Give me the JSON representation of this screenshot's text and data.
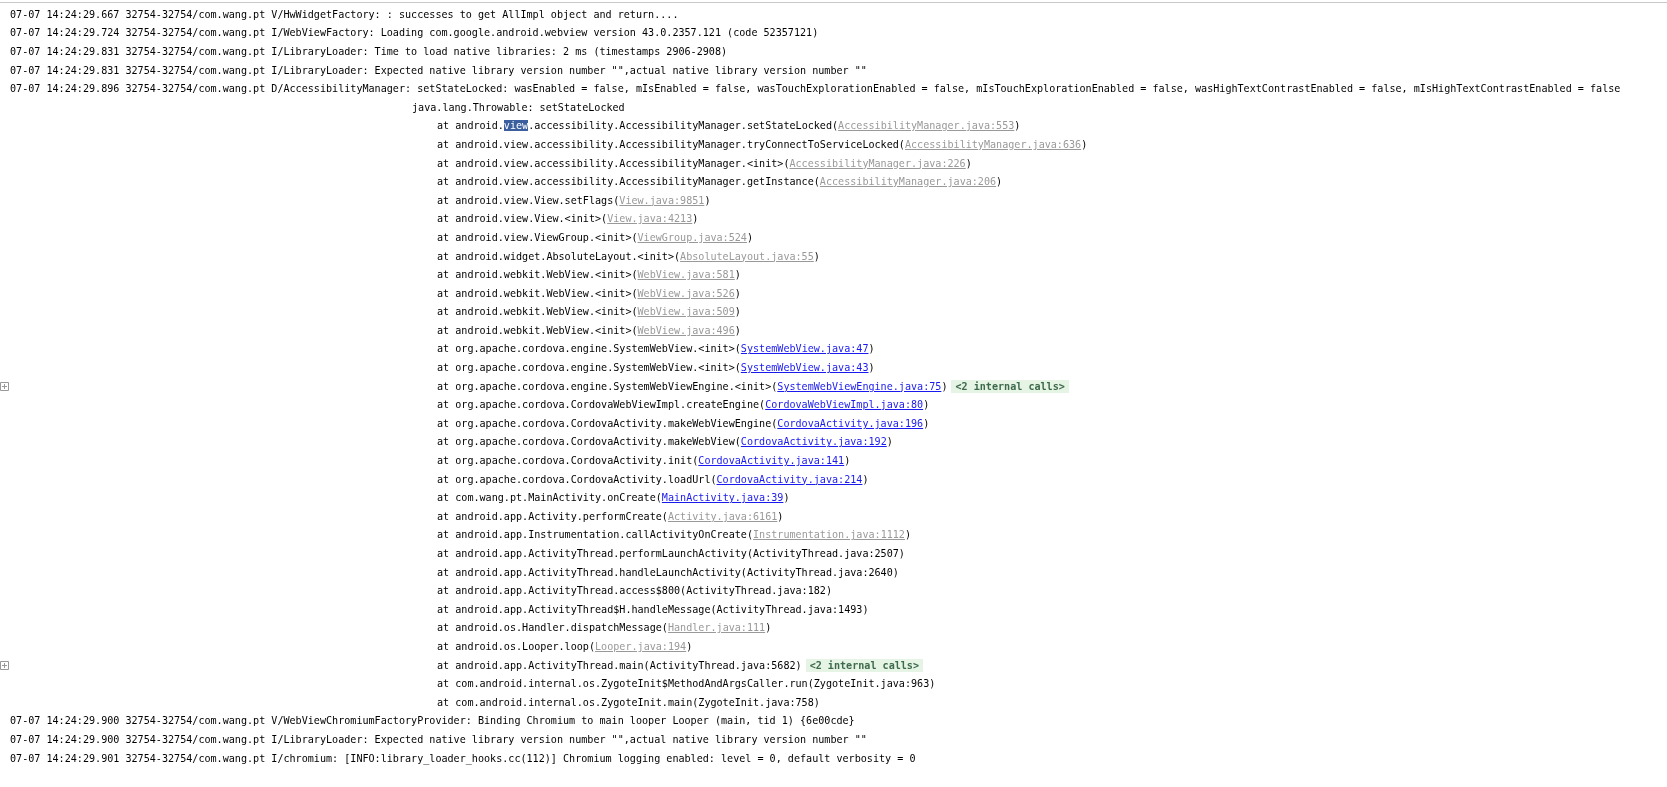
{
  "log": [
    {
      "kind": "line",
      "text": "07-07 14:24:29.667 32754-32754/com.wang.pt V/HwWidgetFactory: : successes to get AllImpl object and return...."
    },
    {
      "kind": "line",
      "text": "07-07 14:24:29.724 32754-32754/com.wang.pt I/WebViewFactory: Loading com.google.android.webview version 43.0.2357.121 (code 52357121)"
    },
    {
      "kind": "line",
      "text": "07-07 14:24:29.831 32754-32754/com.wang.pt I/LibraryLoader: Time to load native libraries: 2 ms (timestamps 2906-2908)"
    },
    {
      "kind": "line",
      "text": "07-07 14:24:29.831 32754-32754/com.wang.pt I/LibraryLoader: Expected native library version number \"\",actual native library version number \"\""
    },
    {
      "kind": "line",
      "text": "07-07 14:24:29.896 32754-32754/com.wang.pt D/AccessibilityManager: setStateLocked: wasEnabled = false, mIsEnabled = false, wasTouchExplorationEnabled = false, mIsTouchExplorationEnabled = false, wasHighTextContrastEnabled = false, mIsHighTextContrastEnabled = false"
    },
    {
      "kind": "exception",
      "text": "java.lang.Throwable: setStateLocked"
    },
    {
      "kind": "frame",
      "segments": [
        {
          "text": "at android.",
          "selected": false
        },
        {
          "text": "view",
          "selected": true
        },
        {
          "text": ".accessibility.AccessibilityManager.setStateLocked(",
          "selected": false
        }
      ],
      "source": "AccessibilityManager.java:553",
      "project": false,
      "end": ")"
    },
    {
      "kind": "frame",
      "method": "at android.view.accessibility.AccessibilityManager.tryConnectToServiceLocked(",
      "source": "AccessibilityManager.java:636",
      "project": false,
      "end": ")"
    },
    {
      "kind": "frame",
      "method": "at android.view.accessibility.AccessibilityManager.<init>(",
      "source": "AccessibilityManager.java:226",
      "project": false,
      "end": ")"
    },
    {
      "kind": "frame",
      "method": "at android.view.accessibility.AccessibilityManager.getInstance(",
      "source": "AccessibilityManager.java:206",
      "project": false,
      "end": ")"
    },
    {
      "kind": "frame",
      "method": "at android.view.View.setFlags(",
      "source": "View.java:9851",
      "project": false,
      "end": ")"
    },
    {
      "kind": "frame",
      "method": "at android.view.View.<init>(",
      "source": "View.java:4213",
      "project": false,
      "end": ")"
    },
    {
      "kind": "frame",
      "method": "at android.view.ViewGroup.<init>(",
      "source": "ViewGroup.java:524",
      "project": false,
      "end": ")"
    },
    {
      "kind": "frame",
      "method": "at android.widget.AbsoluteLayout.<init>(",
      "source": "AbsoluteLayout.java:55",
      "project": false,
      "end": ")"
    },
    {
      "kind": "frame",
      "method": "at android.webkit.WebView.<init>(",
      "source": "WebView.java:581",
      "project": false,
      "end": ")"
    },
    {
      "kind": "frame",
      "method": "at android.webkit.WebView.<init>(",
      "source": "WebView.java:526",
      "project": false,
      "end": ")"
    },
    {
      "kind": "frame",
      "method": "at android.webkit.WebView.<init>(",
      "source": "WebView.java:509",
      "project": false,
      "end": ")"
    },
    {
      "kind": "frame",
      "method": "at android.webkit.WebView.<init>(",
      "source": "WebView.java:496",
      "project": false,
      "end": ")"
    },
    {
      "kind": "frame",
      "method": "at org.apache.cordova.engine.SystemWebView.<init>(",
      "source": "SystemWebView.java:47",
      "project": true,
      "end": ")"
    },
    {
      "kind": "frame",
      "method": "at org.apache.cordova.engine.SystemWebView.<init>(",
      "source": "SystemWebView.java:43",
      "project": true,
      "end": ")"
    },
    {
      "kind": "frame",
      "method": "at org.apache.cordova.engine.SystemWebViewEngine.<init>(",
      "source": "SystemWebViewEngine.java:75",
      "project": true,
      "end": ")",
      "internal": "<2 internal calls>",
      "collapsed": true
    },
    {
      "kind": "frame",
      "method": "at org.apache.cordova.CordovaWebViewImpl.createEngine(",
      "source": "CordovaWebViewImpl.java:80",
      "project": true,
      "end": ")"
    },
    {
      "kind": "frame",
      "method": "at org.apache.cordova.CordovaActivity.makeWebViewEngine(",
      "source": "CordovaActivity.java:196",
      "project": true,
      "end": ")"
    },
    {
      "kind": "frame",
      "method": "at org.apache.cordova.CordovaActivity.makeWebView(",
      "source": "CordovaActivity.java:192",
      "project": true,
      "end": ")"
    },
    {
      "kind": "frame",
      "method": "at org.apache.cordova.CordovaActivity.init(",
      "source": "CordovaActivity.java:141",
      "project": true,
      "end": ")"
    },
    {
      "kind": "frame",
      "method": "at org.apache.cordova.CordovaActivity.loadUrl(",
      "source": "CordovaActivity.java:214",
      "project": true,
      "end": ")"
    },
    {
      "kind": "frame",
      "method": "at com.wang.pt.MainActivity.onCreate(",
      "source": "MainActivity.java:39",
      "project": true,
      "end": ")"
    },
    {
      "kind": "frame",
      "method": "at android.app.Activity.performCreate(",
      "source": "Activity.java:6161",
      "project": false,
      "end": ")"
    },
    {
      "kind": "frame",
      "method": "at android.app.Instrumentation.callActivityOnCreate(",
      "source": "Instrumentation.java:1112",
      "project": false,
      "end": ")"
    },
    {
      "kind": "frame",
      "method": "at android.app.ActivityThread.performLaunchActivity(ActivityThread.java:2507)"
    },
    {
      "kind": "frame",
      "method": "at android.app.ActivityThread.handleLaunchActivity(ActivityThread.java:2640)"
    },
    {
      "kind": "frame",
      "method": "at android.app.ActivityThread.access$800(ActivityThread.java:182)"
    },
    {
      "kind": "frame",
      "method": "at android.app.ActivityThread$H.handleMessage(ActivityThread.java:1493)"
    },
    {
      "kind": "frame",
      "method": "at android.os.Handler.dispatchMessage(",
      "source": "Handler.java:111",
      "project": false,
      "end": ")"
    },
    {
      "kind": "frame",
      "method": "at android.os.Looper.loop(",
      "source": "Looper.java:194",
      "project": false,
      "end": ")"
    },
    {
      "kind": "frame",
      "method": "at android.app.ActivityThread.main(ActivityThread.java:5682)",
      "internal": "<2 internal calls>",
      "collapsed": true
    },
    {
      "kind": "frame",
      "method": "at com.android.internal.os.ZygoteInit$MethodAndArgsCaller.run(ZygoteInit.java:963)"
    },
    {
      "kind": "frame",
      "method": "at com.android.internal.os.ZygoteInit.main(ZygoteInit.java:758)"
    },
    {
      "kind": "line",
      "text": "07-07 14:24:29.900 32754-32754/com.wang.pt V/WebViewChromiumFactoryProvider: Binding Chromium to main looper Looper (main, tid 1) {6e00cde}"
    },
    {
      "kind": "line",
      "text": "07-07 14:24:29.900 32754-32754/com.wang.pt I/LibraryLoader: Expected native library version number \"\",actual native library version number \"\""
    },
    {
      "kind": "line",
      "text": "07-07 14:24:29.901 32754-32754/com.wang.pt I/chromium: [INFO:library_loader_hooks.cc(112)] Chromium logging enabled: level = 0, default verbosity = 0"
    }
  ]
}
